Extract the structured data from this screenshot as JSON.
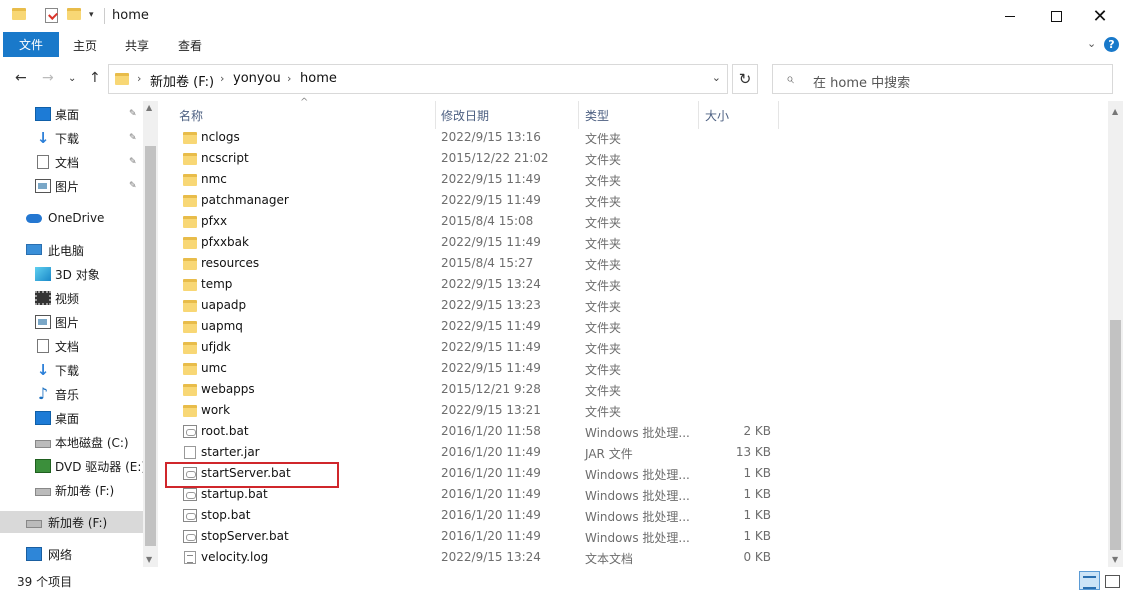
{
  "window": {
    "title": "home",
    "controls": {
      "minimize": "minimize-icon",
      "maximize": "maximize-icon",
      "close": "✕"
    }
  },
  "ribbon": {
    "tabs": [
      "文件",
      "主页",
      "共享",
      "查看"
    ],
    "expand_glyph": "⌄",
    "help_glyph": "?"
  },
  "address": {
    "back": "←",
    "forward": "→",
    "recent": "⌄",
    "up": "↑",
    "crumbs": [
      "新加卷 (F:)",
      "yonyou",
      "home"
    ],
    "separator": "›",
    "dropdown": "⌄",
    "refresh": "↻"
  },
  "search": {
    "placeholder": "在 home 中搜索",
    "icon": "⌕"
  },
  "nav": {
    "items": [
      {
        "label": "桌面",
        "icon": "desktop-icon",
        "pinned": true
      },
      {
        "label": "下载",
        "icon": "download-icon",
        "pinned": true
      },
      {
        "label": "文档",
        "icon": "documents-icon",
        "pinned": true
      },
      {
        "label": "图片",
        "icon": "pictures-icon",
        "pinned": true
      },
      {
        "label": "OneDrive",
        "icon": "onedrive-icon",
        "pinned": false
      },
      {
        "label": "此电脑",
        "icon": "this-pc-icon",
        "pinned": false
      },
      {
        "label": "3D 对象",
        "icon": "3d-objects-icon",
        "pinned": false
      },
      {
        "label": "视频",
        "icon": "videos-icon",
        "pinned": false
      },
      {
        "label": "图片",
        "icon": "pictures-icon",
        "pinned": false
      },
      {
        "label": "文档",
        "icon": "documents-icon",
        "pinned": false
      },
      {
        "label": "下载",
        "icon": "download-icon",
        "pinned": false
      },
      {
        "label": "音乐",
        "icon": "music-icon",
        "pinned": false
      },
      {
        "label": "桌面",
        "icon": "desktop-icon",
        "pinned": false
      },
      {
        "label": "本地磁盘 (C:)",
        "icon": "local-disk-icon",
        "pinned": false
      },
      {
        "label": "DVD 驱动器 (E:)",
        "icon": "dvd-drive-icon",
        "pinned": false
      },
      {
        "label": "新加卷 (F:)",
        "icon": "drive-icon",
        "pinned": false
      },
      {
        "label": "新加卷 (F:)",
        "icon": "drive-icon",
        "pinned": false,
        "selected": true
      },
      {
        "label": "网络",
        "icon": "network-icon",
        "pinned": false
      }
    ],
    "pin_glyph": "📌"
  },
  "columns": {
    "name": "名称",
    "date": "修改日期",
    "type": "类型",
    "size": "大小",
    "sort_glyph": "^"
  },
  "files": [
    {
      "name": "nclogs",
      "date": "2022/9/15 13:16",
      "type": "文件夹",
      "size": "",
      "icon": "folder-icon"
    },
    {
      "name": "ncscript",
      "date": "2015/12/22 21:02",
      "type": "文件夹",
      "size": "",
      "icon": "folder-icon"
    },
    {
      "name": "nmc",
      "date": "2022/9/15 11:49",
      "type": "文件夹",
      "size": "",
      "icon": "folder-icon"
    },
    {
      "name": "patchmanager",
      "date": "2022/9/15 11:49",
      "type": "文件夹",
      "size": "",
      "icon": "folder-icon"
    },
    {
      "name": "pfxx",
      "date": "2015/8/4 15:08",
      "type": "文件夹",
      "size": "",
      "icon": "folder-icon"
    },
    {
      "name": "pfxxbak",
      "date": "2022/9/15 11:49",
      "type": "文件夹",
      "size": "",
      "icon": "folder-icon"
    },
    {
      "name": "resources",
      "date": "2015/8/4 15:27",
      "type": "文件夹",
      "size": "",
      "icon": "folder-icon"
    },
    {
      "name": "temp",
      "date": "2022/9/15 13:24",
      "type": "文件夹",
      "size": "",
      "icon": "folder-icon"
    },
    {
      "name": "uapadp",
      "date": "2022/9/15 13:23",
      "type": "文件夹",
      "size": "",
      "icon": "folder-icon"
    },
    {
      "name": "uapmq",
      "date": "2022/9/15 11:49",
      "type": "文件夹",
      "size": "",
      "icon": "folder-icon"
    },
    {
      "name": "ufjdk",
      "date": "2022/9/15 11:49",
      "type": "文件夹",
      "size": "",
      "icon": "folder-icon"
    },
    {
      "name": "umc",
      "date": "2022/9/15 11:49",
      "type": "文件夹",
      "size": "",
      "icon": "folder-icon"
    },
    {
      "name": "webapps",
      "date": "2015/12/21 9:28",
      "type": "文件夹",
      "size": "",
      "icon": "folder-icon"
    },
    {
      "name": "work",
      "date": "2022/9/15 13:21",
      "type": "文件夹",
      "size": "",
      "icon": "folder-icon"
    },
    {
      "name": "root.bat",
      "date": "2016/1/20 11:58",
      "type": "Windows 批处理...",
      "size": "2 KB",
      "icon": "batch-file-icon"
    },
    {
      "name": "starter.jar",
      "date": "2016/1/20 11:49",
      "type": "JAR 文件",
      "size": "13 KB",
      "icon": "jar-file-icon"
    },
    {
      "name": "startServer.bat",
      "date": "2016/1/20 11:49",
      "type": "Windows 批处理...",
      "size": "1 KB",
      "icon": "batch-file-icon",
      "highlighted": true
    },
    {
      "name": "startup.bat",
      "date": "2016/1/20 11:49",
      "type": "Windows 批处理...",
      "size": "1 KB",
      "icon": "batch-file-icon"
    },
    {
      "name": "stop.bat",
      "date": "2016/1/20 11:49",
      "type": "Windows 批处理...",
      "size": "1 KB",
      "icon": "batch-file-icon"
    },
    {
      "name": "stopServer.bat",
      "date": "2016/1/20 11:49",
      "type": "Windows 批处理...",
      "size": "1 KB",
      "icon": "batch-file-icon"
    },
    {
      "name": "velocity.log",
      "date": "2022/9/15 13:24",
      "type": "文本文档",
      "size": "0 KB",
      "icon": "log-file-icon"
    }
  ],
  "status": {
    "item_count": "39 个项目"
  },
  "colors": {
    "accent": "#1979ca",
    "highlight_border": "#d0262b",
    "selected_bg": "#d9d9d9"
  }
}
